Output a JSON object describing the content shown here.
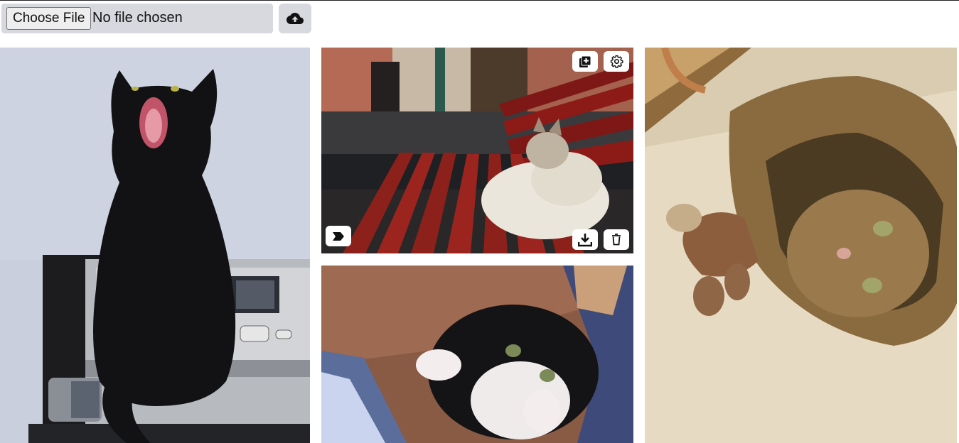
{
  "upload": {
    "choose_label": "Choose File",
    "file_status": "No file chosen",
    "upload_icon": "cloud-upload-icon"
  },
  "gallery": {
    "images": [
      {
        "subject": "black cat yawning",
        "column": 1
      },
      {
        "subject": "cat on red bench",
        "column": 2,
        "actions": [
          "add-to-album-icon",
          "settings-icon",
          "tag-icon",
          "download-icon",
          "delete-icon"
        ]
      },
      {
        "subject": "black and white kitten",
        "column": 2
      },
      {
        "subject": "tabby cat rolling",
        "column": 3
      }
    ]
  },
  "colors": {
    "bar_bg": "#d7d9de",
    "action_bg": "#ffffff"
  }
}
